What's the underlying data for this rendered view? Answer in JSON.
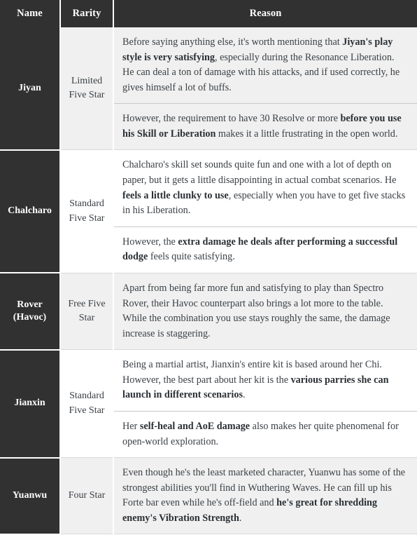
{
  "table": {
    "columns": [
      {
        "key": "name",
        "label": "Name"
      },
      {
        "key": "rarity",
        "label": "Rarity"
      },
      {
        "key": "reason",
        "label": "Reason"
      }
    ],
    "colors": {
      "header_background": "#313131",
      "header_text": "#ffffff",
      "name_cell_background": "#313131",
      "name_cell_text": "#ffffff",
      "stripe_odd_background": "#f0f0f0",
      "stripe_even_background": "#ffffff",
      "body_text": "#3b4045",
      "divider": "#c9c9c9"
    },
    "rows": [
      {
        "name": "Jiyan",
        "rarity": "Limited Five Star",
        "paragraphs": [
          {
            "segments": [
              {
                "text": "Before saying anything else, it's worth mentioning that ",
                "bold": false
              },
              {
                "text": "Jiyan's play style is very satisfying",
                "bold": true
              },
              {
                "text": ", especially during the Resonance Liberation. He can deal a ton of damage with his attacks, and if used correctly, he gives himself a lot of buffs.",
                "bold": false
              }
            ]
          },
          {
            "segments": [
              {
                "text": "However, the requirement to have 30 Resolve or more ",
                "bold": false
              },
              {
                "text": "before you use his Skill or Liberation",
                "bold": true
              },
              {
                "text": " makes it a little frustrating in the open world.",
                "bold": false
              }
            ]
          }
        ]
      },
      {
        "name": "Chalcharo",
        "rarity": "Standard Five Star",
        "paragraphs": [
          {
            "segments": [
              {
                "text": "Chalcharo's skill set sounds quite fun and one with a lot of depth on paper, but it gets a little disappointing in actual combat scenarios. He ",
                "bold": false
              },
              {
                "text": "feels a little clunky to use",
                "bold": true
              },
              {
                "text": ", especially when you have to get five stacks in his Liberation.",
                "bold": false
              }
            ]
          },
          {
            "segments": [
              {
                "text": "However, the ",
                "bold": false
              },
              {
                "text": "extra damage he deals after performing a successful dodge",
                "bold": true
              },
              {
                "text": " feels quite satisfying.",
                "bold": false
              }
            ]
          }
        ]
      },
      {
        "name": "Rover (Havoc)",
        "rarity": "Free Five Star",
        "paragraphs": [
          {
            "segments": [
              {
                "text": "Apart from being far more fun and satisfying to play than Spectro Rover, their Havoc counterpart also brings a lot more to the table. While the combination you use stays roughly the same, the damage increase is staggering.",
                "bold": false
              }
            ]
          }
        ]
      },
      {
        "name": "Jianxin",
        "rarity": "Standard Five Star",
        "paragraphs": [
          {
            "segments": [
              {
                "text": "Being a martial artist, Jianxin's entire kit is based around her Chi. However, the best part about her kit is the ",
                "bold": false
              },
              {
                "text": "various parries she can launch in different scenarios",
                "bold": true
              },
              {
                "text": ".",
                "bold": false
              }
            ]
          },
          {
            "segments": [
              {
                "text": "Her ",
                "bold": false
              },
              {
                "text": "self-heal and AoE damage",
                "bold": true
              },
              {
                "text": " also makes her quite phenomenal for open-world exploration.",
                "bold": false
              }
            ]
          }
        ]
      },
      {
        "name": "Yuanwu",
        "rarity": "Four Star",
        "paragraphs": [
          {
            "segments": [
              {
                "text": "Even though he's the least marketed character, Yuanwu has some of the strongest abilities you'll find in Wuthering Waves. He can fill up his Forte bar even while he's off-field and ",
                "bold": false
              },
              {
                "text": "he's great for shredding enemy's Vibration Strength",
                "bold": true
              },
              {
                "text": ".",
                "bold": false
              }
            ]
          }
        ]
      }
    ]
  }
}
